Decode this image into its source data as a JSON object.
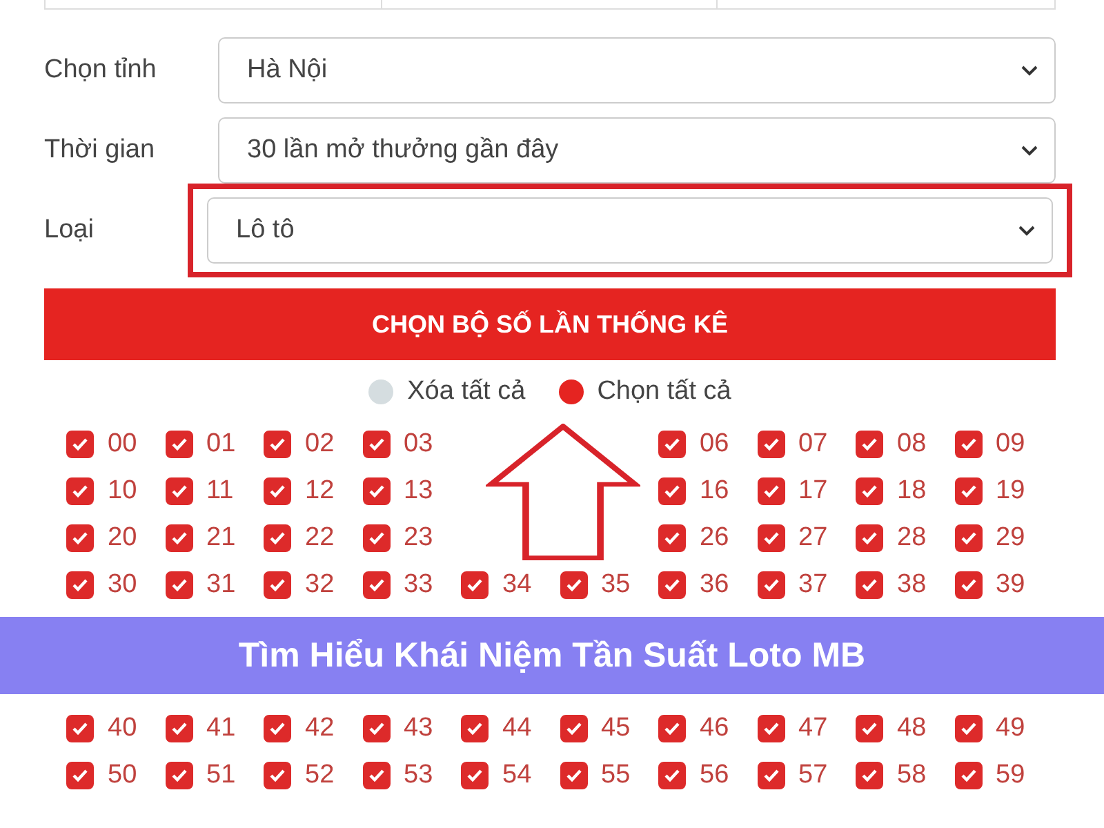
{
  "filters": [
    {
      "label": "Chọn tỉnh",
      "value": "Hà Nội",
      "highlighted": false
    },
    {
      "label": "Thời gian",
      "value": "30 lần mở thưởng gần đây",
      "highlighted": false
    },
    {
      "label": "Loại",
      "value": "Lô tô",
      "highlighted": true
    }
  ],
  "submit_button": "CHỌN BỘ SỐ LẦN THỐNG KÊ",
  "radios": [
    {
      "label": "Xóa tất cả",
      "selected": false
    },
    {
      "label": "Chọn tất cả",
      "selected": true
    }
  ],
  "number_rows": [
    [
      {
        "kind": "checkbox",
        "label": "00",
        "checked": true
      },
      {
        "kind": "checkbox",
        "label": "01",
        "checked": true
      },
      {
        "kind": "checkbox",
        "label": "02",
        "checked": true
      },
      {
        "kind": "checkbox",
        "label": "03",
        "checked": true
      },
      {
        "kind": "blank"
      },
      {
        "kind": "blank"
      },
      {
        "kind": "checkbox",
        "label": "06",
        "checked": true
      },
      {
        "kind": "checkbox",
        "label": "07",
        "checked": true
      },
      {
        "kind": "checkbox",
        "label": "08",
        "checked": true
      },
      {
        "kind": "checkbox",
        "label": "09",
        "checked": true
      }
    ],
    [
      {
        "kind": "checkbox",
        "label": "10",
        "checked": true
      },
      {
        "kind": "checkbox",
        "label": "11",
        "checked": true
      },
      {
        "kind": "checkbox",
        "label": "12",
        "checked": true
      },
      {
        "kind": "checkbox",
        "label": "13",
        "checked": true
      },
      {
        "kind": "blank"
      },
      {
        "kind": "blank"
      },
      {
        "kind": "checkbox",
        "label": "16",
        "checked": true
      },
      {
        "kind": "checkbox",
        "label": "17",
        "checked": true
      },
      {
        "kind": "checkbox",
        "label": "18",
        "checked": true
      },
      {
        "kind": "checkbox",
        "label": "19",
        "checked": true
      }
    ],
    [
      {
        "kind": "checkbox",
        "label": "20",
        "checked": true
      },
      {
        "kind": "checkbox",
        "label": "21",
        "checked": true
      },
      {
        "kind": "checkbox",
        "label": "22",
        "checked": true
      },
      {
        "kind": "checkbox",
        "label": "23",
        "checked": true
      },
      {
        "kind": "blank"
      },
      {
        "kind": "blank"
      },
      {
        "kind": "checkbox",
        "label": "26",
        "checked": true
      },
      {
        "kind": "checkbox",
        "label": "27",
        "checked": true
      },
      {
        "kind": "checkbox",
        "label": "28",
        "checked": true
      },
      {
        "kind": "checkbox",
        "label": "29",
        "checked": true
      }
    ],
    [
      {
        "kind": "checkbox",
        "label": "30",
        "checked": true
      },
      {
        "kind": "checkbox",
        "label": "31",
        "checked": true
      },
      {
        "kind": "checkbox",
        "label": "32",
        "checked": true
      },
      {
        "kind": "checkbox",
        "label": "33",
        "checked": true
      },
      {
        "kind": "checkbox",
        "label": "34",
        "checked": true
      },
      {
        "kind": "checkbox",
        "label": "35",
        "checked": true
      },
      {
        "kind": "checkbox",
        "label": "36",
        "checked": true
      },
      {
        "kind": "checkbox",
        "label": "37",
        "checked": true
      },
      {
        "kind": "checkbox",
        "label": "38",
        "checked": true
      },
      {
        "kind": "checkbox",
        "label": "39",
        "checked": true
      }
    ],
    [
      {
        "kind": "checkbox",
        "label": "40",
        "checked": true
      },
      {
        "kind": "checkbox",
        "label": "41",
        "checked": true
      },
      {
        "kind": "checkbox",
        "label": "42",
        "checked": true
      },
      {
        "kind": "checkbox",
        "label": "43",
        "checked": true
      },
      {
        "kind": "checkbox",
        "label": "44",
        "checked": true
      },
      {
        "kind": "checkbox",
        "label": "45",
        "checked": true
      },
      {
        "kind": "checkbox",
        "label": "46",
        "checked": true
      },
      {
        "kind": "checkbox",
        "label": "47",
        "checked": true
      },
      {
        "kind": "checkbox",
        "label": "48",
        "checked": true
      },
      {
        "kind": "checkbox",
        "label": "49",
        "checked": true
      }
    ],
    [
      {
        "kind": "checkbox",
        "label": "50",
        "checked": true
      },
      {
        "kind": "checkbox",
        "label": "51",
        "checked": true
      },
      {
        "kind": "checkbox",
        "label": "52",
        "checked": true
      },
      {
        "kind": "checkbox",
        "label": "53",
        "checked": true
      },
      {
        "kind": "checkbox",
        "label": "54",
        "checked": true
      },
      {
        "kind": "checkbox",
        "label": "55",
        "checked": true
      },
      {
        "kind": "checkbox",
        "label": "56",
        "checked": true
      },
      {
        "kind": "checkbox",
        "label": "57",
        "checked": true
      },
      {
        "kind": "checkbox",
        "label": "58",
        "checked": true
      },
      {
        "kind": "checkbox",
        "label": "59",
        "checked": true
      }
    ]
  ],
  "banner": "Tìm Hiểu Khái Niệm Tần Suất Loto MB"
}
